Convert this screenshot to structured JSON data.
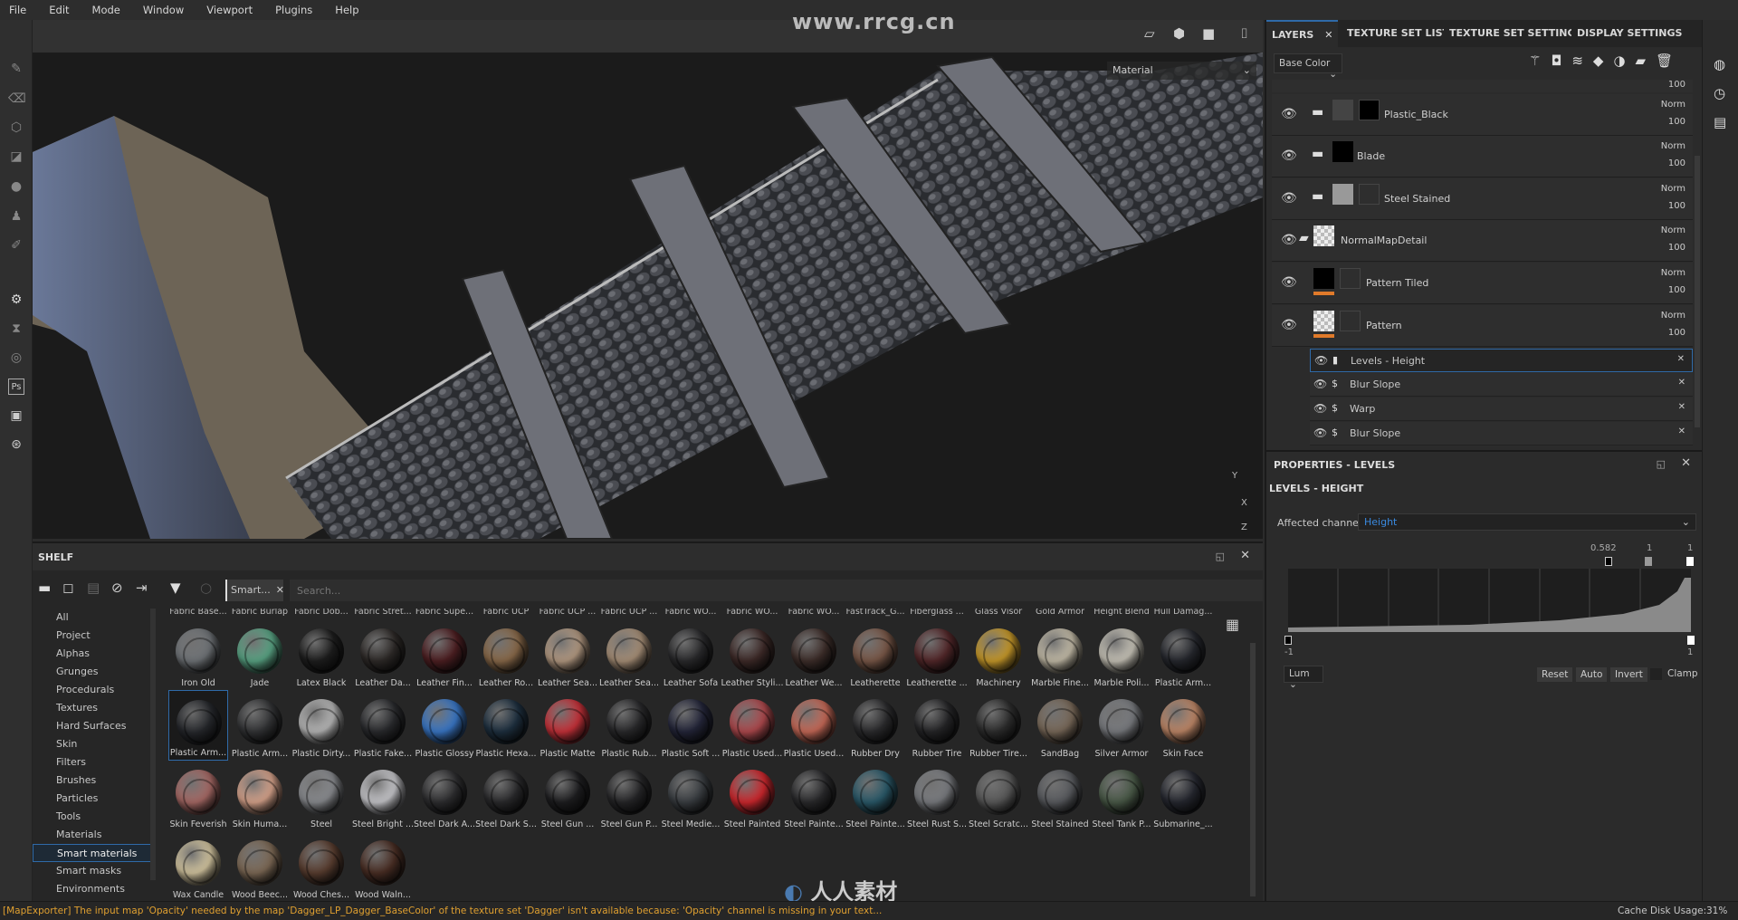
{
  "menu": [
    "File",
    "Edit",
    "Mode",
    "Window",
    "Viewport",
    "Plugins",
    "Help"
  ],
  "watermark": "www.rrcg.cn",
  "viewport": {
    "render_mode": "Material",
    "axis_labels": [
      "Y",
      "X",
      "Z"
    ]
  },
  "shelf": {
    "title": "SHELF",
    "filter_chip": "Smart...",
    "search_placeholder": "Search...",
    "categories": [
      "All",
      "Project",
      "Alphas",
      "Grunges",
      "Procedurals",
      "Textures",
      "Hard Surfaces",
      "Skin",
      "Filters",
      "Brushes",
      "Particles",
      "Tools",
      "Materials",
      "Smart materials",
      "Smart masks",
      "Environments"
    ],
    "selected_category": "Smart materials",
    "top_row_labels": [
      "Fabric Base...",
      "Fabric Burlap",
      "Fabric Dob...",
      "Fabric Stret...",
      "Fabric Supe...",
      "Fabric UCP",
      "Fabric UCP ...",
      "Fabric UCP ...",
      "Fabric WO...",
      "Fabric WO...",
      "Fabric WO...",
      "FastTrack_G...",
      "Fiberglass ...",
      "Glass Visor",
      "Gold Armor",
      "Height Blend",
      "Hull Damag..."
    ],
    "materials": [
      [
        {
          "n": "Iron Old",
          "c": "#707478"
        },
        {
          "n": "Jade",
          "c": "#5aa585"
        },
        {
          "n": "Latex Black",
          "c": "#1e1e1e"
        },
        {
          "n": "Leather Da...",
          "c": "#2e2a28"
        },
        {
          "n": "Leather Fin...",
          "c": "#4e1f22"
        },
        {
          "n": "Leather Ro...",
          "c": "#8a6a4a"
        },
        {
          "n": "Leather Sea...",
          "c": "#b49a82"
        },
        {
          "n": "Leather Sea...",
          "c": "#a89078"
        },
        {
          "n": "Leather Sofa",
          "c": "#2a2a2c"
        },
        {
          "n": "Leather Styli...",
          "c": "#3e2a28"
        },
        {
          "n": "Leather We...",
          "c": "#3e2e2a"
        },
        {
          "n": "Leatherette",
          "c": "#7a5848"
        },
        {
          "n": "Leatherette ...",
          "c": "#54282a"
        },
        {
          "n": "Machinery",
          "c": "#c89a2a"
        },
        {
          "n": "Marble Fine...",
          "c": "#c4bca8"
        },
        {
          "n": "Marble Poli...",
          "c": "#c8c4b8"
        },
        {
          "n": "Plastic Arm...",
          "c": "#26282e"
        }
      ],
      [
        {
          "n": "Plastic Arm...",
          "c": "#26282c",
          "sel": true
        },
        {
          "n": "Plastic Arm...",
          "c": "#333436"
        },
        {
          "n": "Plastic Dirty...",
          "c": "#b8b8b8"
        },
        {
          "n": "Plastic Fake...",
          "c": "#2a2b2e"
        },
        {
          "n": "Plastic Glossy",
          "c": "#3a78c8"
        },
        {
          "n": "Plastic Hexa...",
          "c": "#1e3040"
        },
        {
          "n": "Plastic Matte",
          "c": "#c8323a"
        },
        {
          "n": "Plastic Rub...",
          "c": "#2a2a2c"
        },
        {
          "n": "Plastic Soft ...",
          "c": "#24263a"
        },
        {
          "n": "Plastic Used...",
          "c": "#b04a4e"
        },
        {
          "n": "Plastic Used...",
          "c": "#c86a58"
        },
        {
          "n": "Rubber Dry",
          "c": "#2c2c2e"
        },
        {
          "n": "Rubber Tire",
          "c": "#262628"
        },
        {
          "n": "Rubber Tire...",
          "c": "#2e2e2e"
        },
        {
          "n": "SandBag",
          "c": "#7a6a5a"
        },
        {
          "n": "Silver Armor",
          "c": "#7a7c80"
        },
        {
          "n": "Skin Face",
          "c": "#c08868"
        }
      ],
      [
        {
          "n": "Skin Feverish",
          "c": "#a86a66"
        },
        {
          "n": "Skin Huma...",
          "c": "#d8a48c"
        },
        {
          "n": "Steel",
          "c": "#8a8c90"
        },
        {
          "n": "Steel Bright ...",
          "c": "#c8c8cc"
        },
        {
          "n": "Steel Dark A...",
          "c": "#2e2e30"
        },
        {
          "n": "Steel Dark S...",
          "c": "#2a2a2c"
        },
        {
          "n": "Steel Gun ...",
          "c": "#1e1e20"
        },
        {
          "n": "Steel Gun P...",
          "c": "#262628"
        },
        {
          "n": "Steel Medie...",
          "c": "#3a3e42"
        },
        {
          "n": "Steel Painted",
          "c": "#d0282e"
        },
        {
          "n": "Steel Painte...",
          "c": "#2a2a2c"
        },
        {
          "n": "Steel Painte...",
          "c": "#2a5a6a"
        },
        {
          "n": "Steel Rust S...",
          "c": "#7a7c80"
        },
        {
          "n": "Steel Scratc...",
          "c": "#5a5a5a"
        },
        {
          "n": "Steel Stained",
          "c": "#5a5c60"
        },
        {
          "n": "Steel Tank P...",
          "c": "#4a5a48"
        },
        {
          "n": "Submarine_...",
          "c": "#262830"
        }
      ],
      [
        {
          "n": "Wax Candle",
          "c": "#d4c6a0"
        },
        {
          "n": "Wood Beec...",
          "c": "#7e6a56"
        },
        {
          "n": "Wood Ches...",
          "c": "#5a3e30"
        },
        {
          "n": "Wood Waln...",
          "c": "#4a2e24"
        }
      ]
    ]
  },
  "layers_panel": {
    "tabs": [
      "LAYERS",
      "TEXTURE SET LIST",
      "TEXTURE SET SETTINGS",
      "DISPLAY SETTINGS"
    ],
    "channel": "Base Color",
    "partial_opacity": "100",
    "layers": [
      {
        "name": "Plastic_Black",
        "blend": "Norm",
        "opacity": "100"
      },
      {
        "name": "Blade",
        "blend": "Norm",
        "opacity": "100"
      },
      {
        "name": "Steel Stained",
        "blend": "Norm",
        "opacity": "100"
      },
      {
        "name": "NormalMapDetail",
        "blend": "Norm",
        "opacity": "100"
      },
      {
        "name": "Pattern Tiled",
        "blend": "Norm",
        "opacity": "100"
      },
      {
        "name": "Pattern",
        "blend": "Norm",
        "opacity": "100"
      }
    ],
    "effects": [
      "Levels - Height",
      "Blur Slope",
      "Warp",
      "Blur Slope"
    ]
  },
  "properties": {
    "title": "PROPERTIES - LEVELS",
    "subtitle": "LEVELS - HEIGHT",
    "channel_label": "Affected channel:",
    "channel_value": "Height",
    "input_markers": {
      "low": "0.582",
      "mid": "1",
      "high": "1"
    },
    "output_range": {
      "min": "-1",
      "max": "1"
    },
    "mode": "Lum",
    "buttons": [
      "Reset",
      "Auto",
      "Invert"
    ],
    "clamp_label": "Clamp"
  },
  "status": {
    "message": "[MapExporter] The input map 'Opacity' needed by the map 'Dagger_LP_Dagger_BaseColor' of the texture set 'Dagger' isn't available because: 'Opacity' channel is missing in your text...",
    "cache": "Cache Disk Usage:",
    "cache_value": "31%"
  },
  "colors": {
    "accent": "#2f6aa8",
    "warning": "#e0a030",
    "orange_mask": "#e07a2a"
  },
  "logo_text": "人人素材"
}
